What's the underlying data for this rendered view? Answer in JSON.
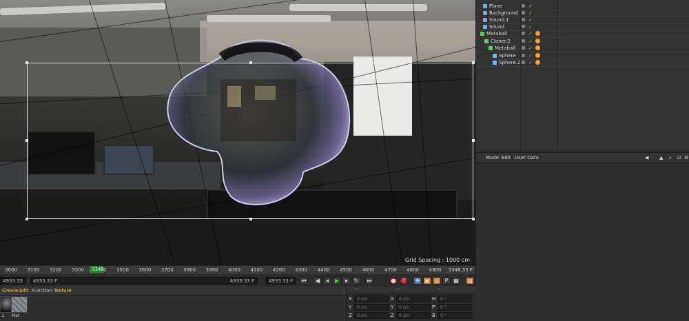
{
  "viewport": {
    "grid_spacing": "Grid Spacing : 1000 cm"
  },
  "objects": {
    "items": [
      {
        "name": "Plane",
        "icon": "plane-icon",
        "color": "#7fa7e0"
      },
      {
        "name": "Background",
        "icon": "background-icon",
        "color": "#7fa7e0"
      },
      {
        "name": "Sound.1",
        "icon": "sound-icon",
        "color": "#7fa7e0"
      },
      {
        "name": "Sound",
        "icon": "sound-icon",
        "color": "#7fa7e0"
      },
      {
        "name": "Metaball",
        "icon": "metaball-icon",
        "color": "#5fcf58"
      },
      {
        "name": "Cloner.2",
        "icon": "cloner-icon",
        "color": "#5fcf58"
      },
      {
        "name": "Metaball",
        "icon": "metaball-icon",
        "color": "#5fcf58"
      },
      {
        "name": "Sphere",
        "icon": "sphere-icon",
        "color": "#6fb6ff"
      },
      {
        "name": "Sphere.2",
        "icon": "sphere-icon",
        "color": "#6fb6ff"
      }
    ]
  },
  "attributes": {
    "menu": [
      "Mode",
      "Edit",
      "User Data"
    ]
  },
  "timeline": {
    "ticks": [
      "3000",
      "3100",
      "3200",
      "3300",
      "3400",
      "3500",
      "3600",
      "3700",
      "3800",
      "3900",
      "4000",
      "4100",
      "4200",
      "4300",
      "4400",
      "4500",
      "4600",
      "4700",
      "4800",
      "4900"
    ],
    "playhead_label": "3348",
    "frame_label": "3348.33 F",
    "field_start": "4933.33 F",
    "field_start2": "4933.33 F",
    "field_range_left": "4933.33 F",
    "field_range_right": "4933.33 F",
    "field_end": "4933.33 F"
  },
  "materials": {
    "menu": [
      "Create",
      "Edit",
      "Function",
      "Texture"
    ],
    "items": [
      {
        "name": ".1"
      },
      {
        "name": "Mat"
      }
    ]
  },
  "coordinates": {
    "header": [
      "--",
      "--",
      "--"
    ],
    "rows": [
      {
        "pos_label": "X",
        "pos": "0 cm",
        "size_label": "X",
        "size": "0 cm",
        "rot_label": "H",
        "rot": "0 °"
      },
      {
        "pos_label": "Y",
        "pos": "0 cm",
        "size_label": "Y",
        "size": "0 cm",
        "rot_label": "P",
        "rot": "0 °"
      },
      {
        "pos_label": "Z",
        "pos": "0 cm",
        "size_label": "Z",
        "size": "0 cm",
        "rot_label": "B",
        "rot": "0 °"
      }
    ]
  }
}
